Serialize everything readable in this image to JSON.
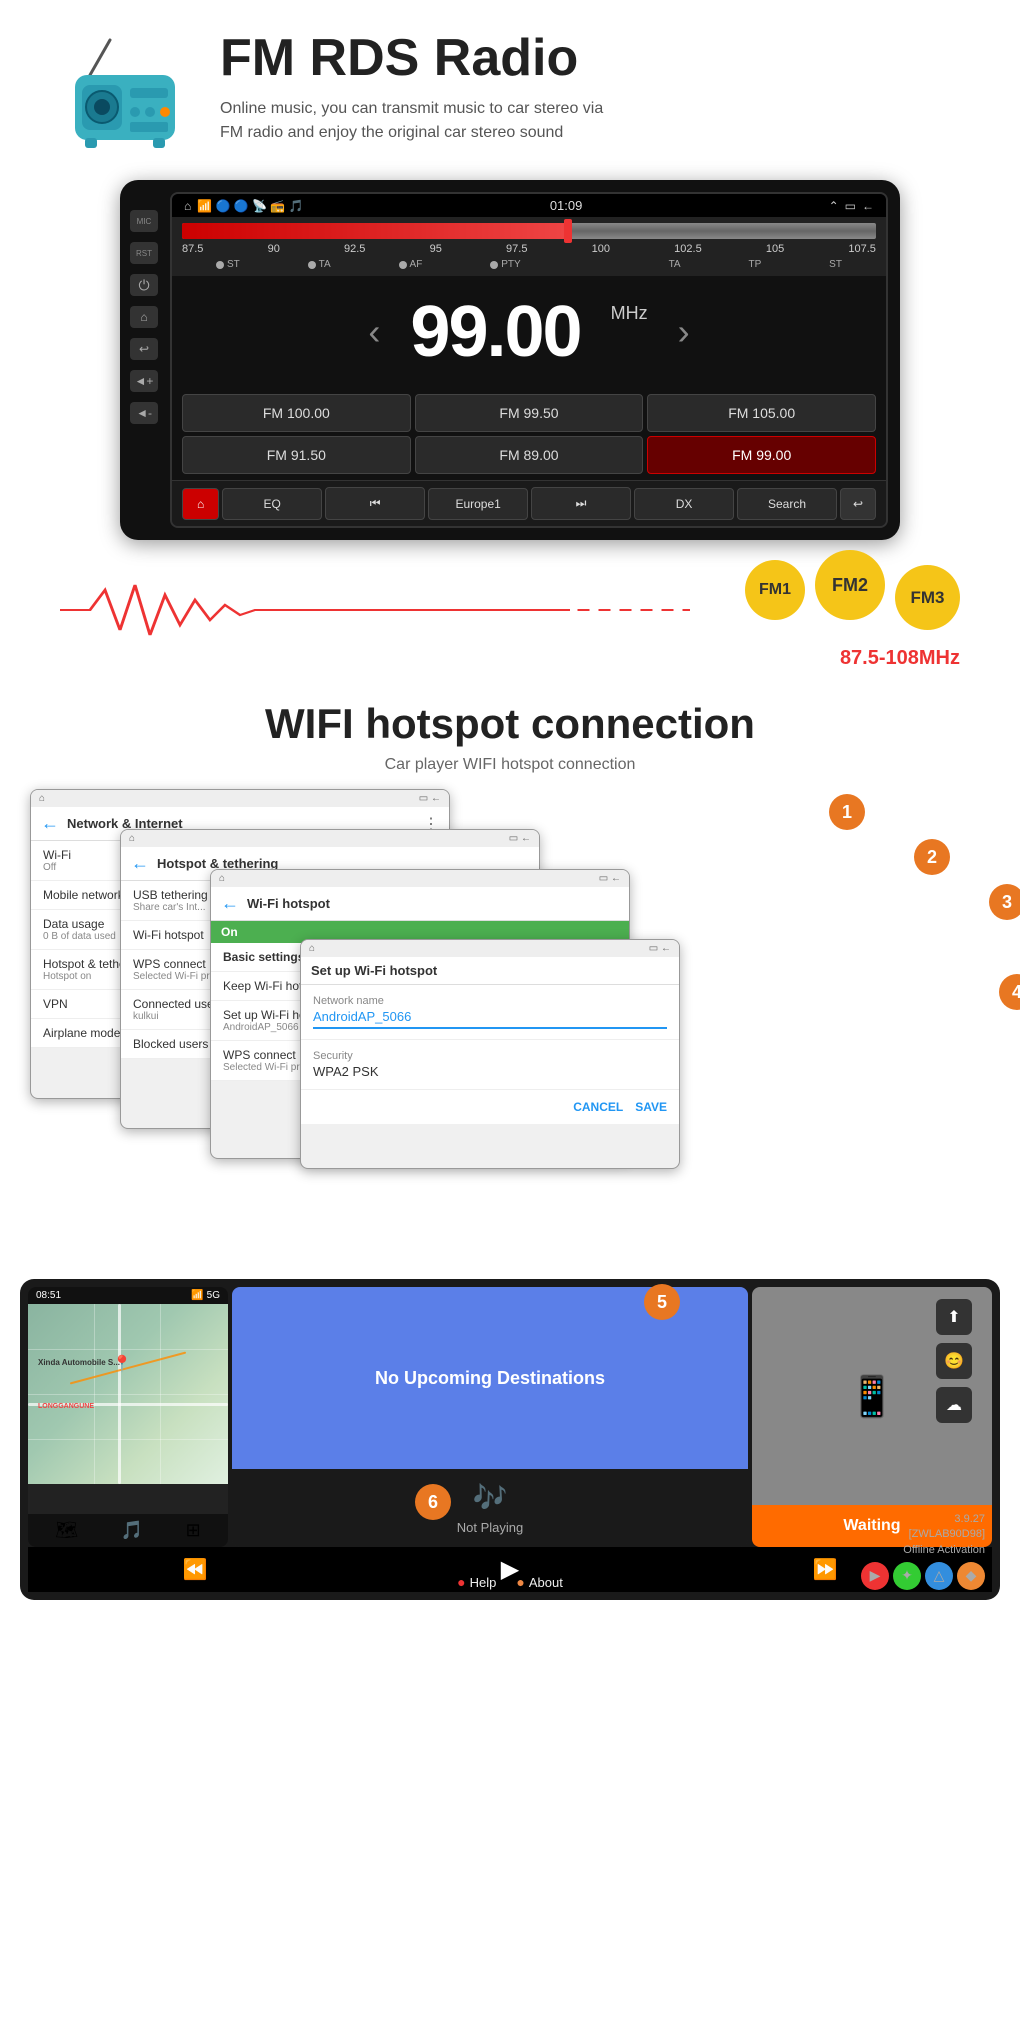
{
  "fm": {
    "title": "FM RDS Radio",
    "desc_line1": "Online music, you can transmit music to car stereo via",
    "desc_line2": "FM radio and enjoy the original car stereo sound",
    "frequency": "99.00",
    "unit": "MHz",
    "time": "01:09",
    "tuner_marks": [
      "87.5",
      "90",
      "92.5",
      "95",
      "97.5",
      "100",
      "102.5",
      "105",
      "107.5"
    ],
    "presets": [
      {
        "label": "FM  100.00",
        "active": false
      },
      {
        "label": "FM  99.50",
        "active": false
      },
      {
        "label": "FM  105.00",
        "active": false
      },
      {
        "label": "FM  91.50",
        "active": false
      },
      {
        "label": "FM  89.00",
        "active": false
      },
      {
        "label": "FM  99.00",
        "active": true
      }
    ],
    "bottom_controls": [
      "EQ",
      "◀◀",
      "Europe1",
      "▶▶",
      "DX",
      "Search",
      "↩"
    ],
    "fm_bands": [
      "FM1",
      "FM2",
      "FM3"
    ],
    "freq_range": "87.5-108MHz",
    "tuner_labels": [
      "ST",
      "TA",
      "AF",
      "PTY",
      "TA",
      "TP",
      "ST"
    ]
  },
  "wifi": {
    "title": "WIFI hotspot connection",
    "desc": "Car player WIFI hotspot connection",
    "screen1": {
      "title": "Network & Internet",
      "rows": [
        "Wi-Fi\nOff",
        "Mobile network",
        "Data usage\n0 B of data used",
        "Hotspot & tethering\nHotspot on",
        "VPN",
        "Airplane mode"
      ]
    },
    "screen2": {
      "title": "Hotspot & tethering",
      "rows": [
        "USB tethering\nShare car's Int...",
        "Wi-Fi hotspot",
        "WPS connect\nSelected Wi-Fi protected setu...",
        "Connected users\nkulkui",
        "Blocked users"
      ]
    },
    "screen3": {
      "title": "Wi-Fi hotspot",
      "on_label": "On",
      "basic_settings": "Basic settings",
      "keep_label": "Keep Wi-Fi hotspot on",
      "setup_label": "Set up Wi-Fi hotspot",
      "setup_val": "AndroidAP_5066 WPA2 PSK",
      "wps_label": "WPS connect",
      "wps_val": "Selected Wi-Fi protected setu..."
    },
    "screen4": {
      "title": "Set up Wi-Fi hotspot",
      "network_name_label": "Network name",
      "network_name_val": "AndroidAP_5066",
      "security_label": "Security",
      "security_val": "WPA2 PSK",
      "cancel_label": "CANCEL",
      "save_label": "SAVE"
    },
    "badges": [
      "1",
      "2",
      "3",
      "4"
    ]
  },
  "carplay": {
    "no_dest": "No Upcoming Destinations",
    "waiting": "Waiting",
    "not_playing": "Not Playing",
    "map_label": "Xinda Automobile S...",
    "time": "08:51",
    "signal": "5G",
    "help": "Help",
    "about": "About",
    "version": "3.9.27\n[ZWLAB90D98]\nOffline Activation",
    "badge5": "5",
    "badge6": "6",
    "longgangune_label": "LONGGANGUNE"
  }
}
